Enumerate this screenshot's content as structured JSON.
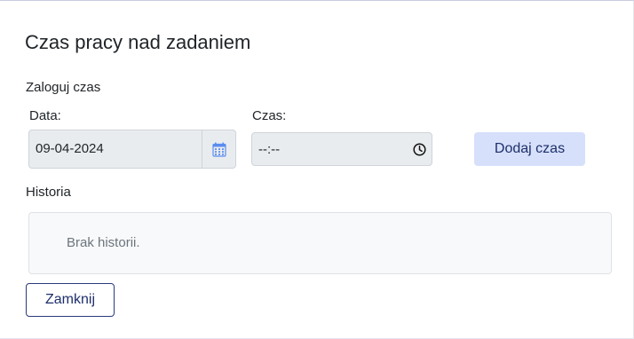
{
  "dialog": {
    "title": "Czas pracy nad zadaniem"
  },
  "log_time": {
    "section_label": "Zaloguj czas",
    "date": {
      "label": "Data:",
      "value": "09-04-2024",
      "icon": "calendar-icon"
    },
    "time": {
      "label": "Czas:",
      "value": "--:--",
      "icon": "clock-icon"
    },
    "add_button_label": "Dodaj czas"
  },
  "history": {
    "section_label": "Historia",
    "empty_text": "Brak historii."
  },
  "footer": {
    "close_button_label": "Zamknij"
  },
  "colors": {
    "accent": "#1e2f6b",
    "primary_button_bg": "#d6e0fb",
    "input_bg": "#e9ecef",
    "calendar_icon": "#5b8def"
  }
}
